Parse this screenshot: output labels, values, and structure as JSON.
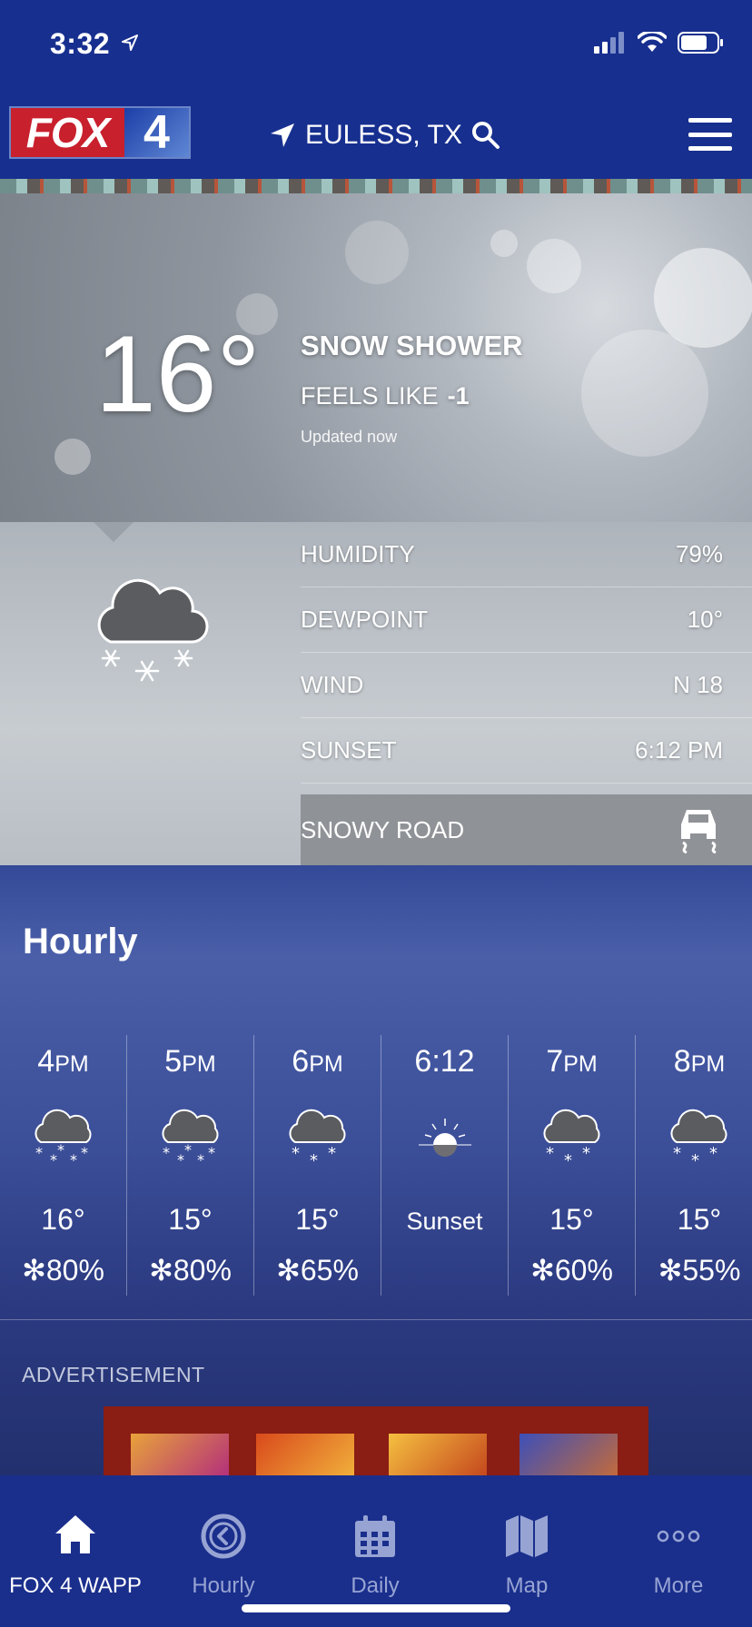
{
  "status": {
    "time": "3:32"
  },
  "header": {
    "logo_text": "FOX",
    "logo_num": "4",
    "location": "EULESS, TX"
  },
  "current": {
    "temperature": "16°",
    "condition": "SNOW SHOWER",
    "feels_label": "FEELS LIKE",
    "feels_value": "-1",
    "updated": "Updated now"
  },
  "details": [
    {
      "label": "HUMIDITY",
      "value": "79%"
    },
    {
      "label": "DEWPOINT",
      "value": "10°"
    },
    {
      "label": "WIND",
      "value": "N 18"
    },
    {
      "label": "SUNSET",
      "value": "6:12 PM"
    }
  ],
  "road": {
    "label": "SNOWY ROAD"
  },
  "hourly": {
    "title": "Hourly",
    "items": [
      {
        "hour": "4",
        "suffix": "PM",
        "icon": "snow-cloud-icon",
        "temp": "16°",
        "precip": "80%"
      },
      {
        "hour": "5",
        "suffix": "PM",
        "icon": "snow-cloud-icon",
        "temp": "15°",
        "precip": "80%"
      },
      {
        "hour": "6",
        "suffix": "PM",
        "icon": "snow-cloud-icon",
        "temp": "15°",
        "precip": "65%"
      },
      {
        "hour": "6:12",
        "suffix": "",
        "icon": "sunset-icon",
        "temp": "Sunset",
        "precip": ""
      },
      {
        "hour": "7",
        "suffix": "PM",
        "icon": "snow-cloud-icon",
        "temp": "15°",
        "precip": "60%"
      },
      {
        "hour": "8",
        "suffix": "PM",
        "icon": "snow-cloud-icon",
        "temp": "15°",
        "precip": "55%"
      }
    ]
  },
  "ad": {
    "label": "ADVERTISEMENT"
  },
  "tabs": [
    {
      "label": "FOX 4 WAPP",
      "icon": "home-icon",
      "active": true
    },
    {
      "label": "Hourly",
      "icon": "clock-icon",
      "active": false
    },
    {
      "label": "Daily",
      "icon": "calendar-icon",
      "active": false
    },
    {
      "label": "Map",
      "icon": "map-icon",
      "active": false
    },
    {
      "label": "More",
      "icon": "more-dots-icon",
      "active": false
    }
  ],
  "colors": {
    "header_bg": "#172f8f",
    "tabbar_bg": "#1a2e8c",
    "logo_red": "#c8202d"
  }
}
